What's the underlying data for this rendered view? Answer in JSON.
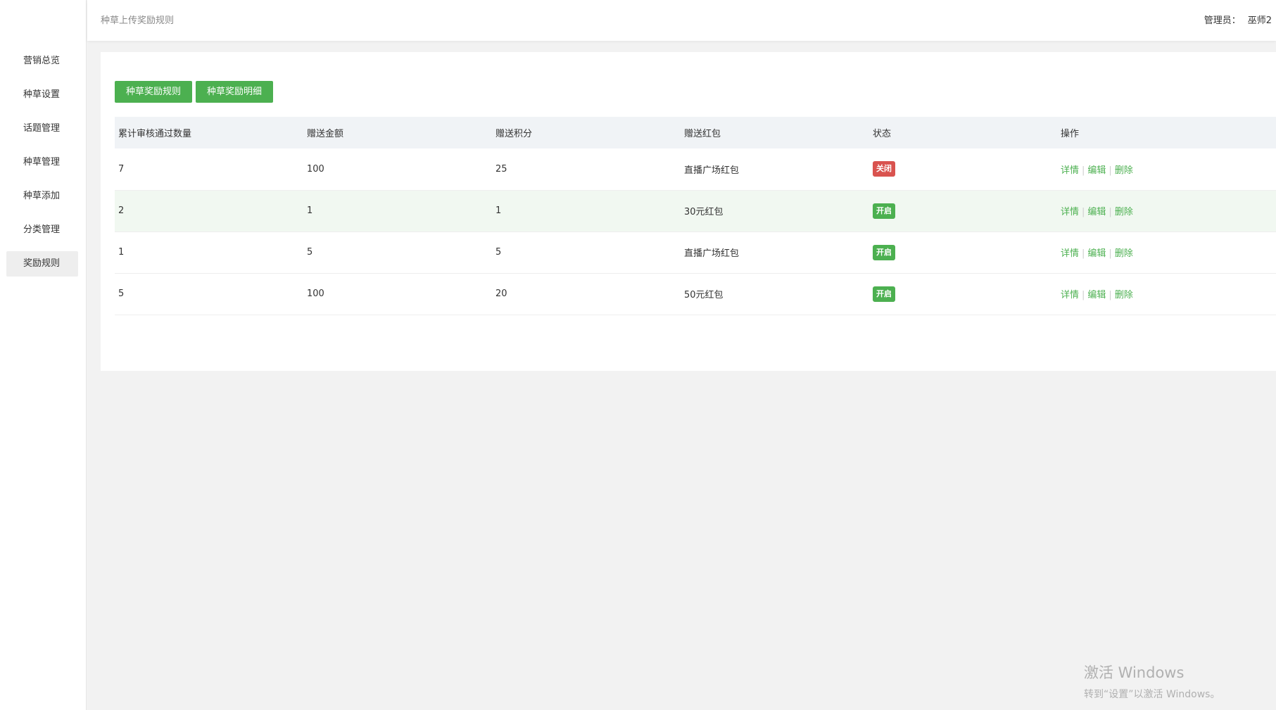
{
  "sidebar": {
    "items": [
      {
        "label": "营销总览"
      },
      {
        "label": "种草设置"
      },
      {
        "label": "话题管理"
      },
      {
        "label": "种草管理"
      },
      {
        "label": "种草添加"
      },
      {
        "label": "分类管理"
      },
      {
        "label": "奖励规则",
        "active": true
      }
    ]
  },
  "header": {
    "title": "种草上传奖励规则",
    "admin_label": "管理员：",
    "admin_name": "巫师2"
  },
  "tabs": {
    "rules_label": "种草奖励规则",
    "details_label": "种草奖励明细"
  },
  "table": {
    "headers": [
      "累计审核通过数量",
      "赠送金额",
      "赠送积分",
      "赠送红包",
      "状态",
      "操作"
    ],
    "rows": [
      {
        "count": "7",
        "amount": "100",
        "points": "25",
        "redpacket": "直播广场红包",
        "status": "关闭",
        "status_key": "off"
      },
      {
        "count": "2",
        "amount": "1",
        "points": "1",
        "redpacket": "30元红包",
        "status": "开启",
        "status_key": "on"
      },
      {
        "count": "1",
        "amount": "5",
        "points": "5",
        "redpacket": "直播广场红包",
        "status": "开启",
        "status_key": "on"
      },
      {
        "count": "5",
        "amount": "100",
        "points": "20",
        "redpacket": "50元红包",
        "status": "开启",
        "status_key": "on"
      }
    ],
    "actions": {
      "detail": "详情",
      "edit": "编辑",
      "delete": "删除",
      "separator": "|"
    }
  },
  "watermark": {
    "line1": "激活 Windows",
    "line2": "转到“设置”以激活 Windows。"
  },
  "colors": {
    "accent_green": "#4cb050",
    "status_off": "#d9534f",
    "header_bg": "#f0f3f6",
    "alt_row_bg": "#f1f8f1"
  }
}
